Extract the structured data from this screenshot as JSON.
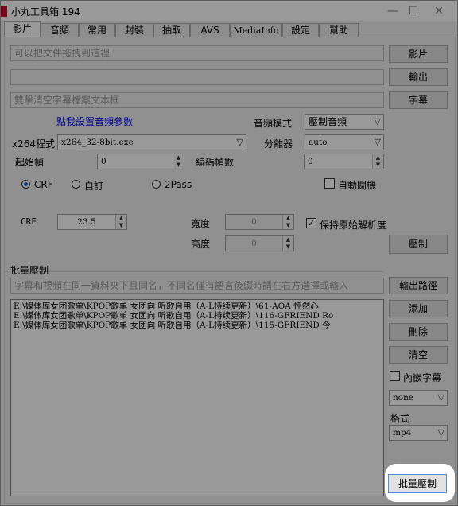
{
  "window": {
    "title": "小丸工具箱 194",
    "minimize": "—",
    "maximize": "☐",
    "close": "✕"
  },
  "tabs": [
    "影片",
    "音頻",
    "常用",
    "封裝",
    "抽取",
    "AVS",
    "MediaInfo",
    "設定",
    "幫助"
  ],
  "video": {
    "drop_placeholder": "可以把文件拖拽到這裡",
    "output_value": "",
    "subtitle_placeholder": "雙擊清空字幕檔案文本框",
    "video_btn": "影片",
    "output_btn": "輸出",
    "subtitle_btn": "字幕",
    "audio_params_link": "點我設置音頻參數",
    "audio_mode_label": "音頻模式",
    "audio_mode_value": "壓制音頻",
    "x264_label": "x264程式",
    "x264_value": "x264_32-8bit.exe",
    "splitter_label": "分離器",
    "splitter_value": "auto",
    "start_frame_label": "起始幀",
    "start_frame_value": "0",
    "encode_frames_label": "編碼幀數",
    "encode_frames_value": "0",
    "mode_crf": "CRF",
    "mode_custom": "自訂",
    "mode_2pass": "2Pass",
    "auto_shutdown": "自動關機",
    "crf_label": "CRF",
    "crf_value": "23.5",
    "width_label": "寬度",
    "width_value": "0",
    "height_label": "高度",
    "height_value": "0",
    "keep_res": "保持原始解析度",
    "encode_btn": "壓制"
  },
  "batch": {
    "section_label": "批量壓制",
    "hint": "字幕和視頻在同一資料夾下且同名，不同名僅有語言後綴時請在右方選擇或輸入",
    "output_path_btn": "輸出路徑",
    "add_btn": "添加",
    "delete_btn": "刪除",
    "clear_btn": "清空",
    "embed_subtitle": "內嵌字幕",
    "subtitle_lang_value": "none",
    "format_label": "格式",
    "format_value": "mp4",
    "batch_encode_btn": "批量壓制",
    "files": [
      "E:\\媒体库女团歌单\\KPOP歌单  女团向  听歌自用（A-L持续更新）\\61-AOA 怦然心",
      "E:\\媒体库女团歌单\\KPOP歌单  女团向  听歌自用（A-L持续更新）\\116-GFRIEND Ro",
      "E:\\媒体库女团歌单\\KPOP歌单  女团向  听歌自用（A-L持续更新）\\115-GFRIEND 今"
    ]
  },
  "icons": {
    "dropdown": "▽",
    "spin_up": "▲",
    "spin_down": "▼",
    "check": "✓"
  }
}
